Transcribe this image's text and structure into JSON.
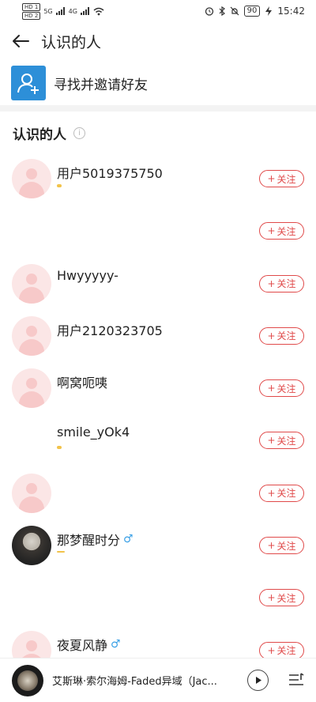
{
  "status_bar": {
    "sim1": "HD 1",
    "sim2": "HD 2",
    "net1": "5G",
    "net2": "4G",
    "battery": "90",
    "time": "15:42"
  },
  "header": {
    "title": "认识的人"
  },
  "find_friends": {
    "label": "寻找并邀请好友"
  },
  "section": {
    "title": "认识的人",
    "info": "i"
  },
  "follow_label": "关注",
  "follow_plus": "+",
  "people": [
    {
      "name": "用户5019375750",
      "gender": ""
    },
    {
      "name": "",
      "gender": ""
    },
    {
      "name": "Hwyyyyy-",
      "gender": ""
    },
    {
      "name": "用户2120323705",
      "gender": ""
    },
    {
      "name": "啊窝呃咦",
      "gender": ""
    },
    {
      "name": "smile_yOk4",
      "gender": ""
    },
    {
      "name": "",
      "gender": ""
    },
    {
      "name": "那梦醒时分",
      "gender": "♂"
    },
    {
      "name": "",
      "gender": ""
    },
    {
      "name": "夜夏风静",
      "gender": "♂"
    }
  ],
  "player": {
    "song": "艾斯琳·索尔海姆-Faded异域（Jac..."
  }
}
